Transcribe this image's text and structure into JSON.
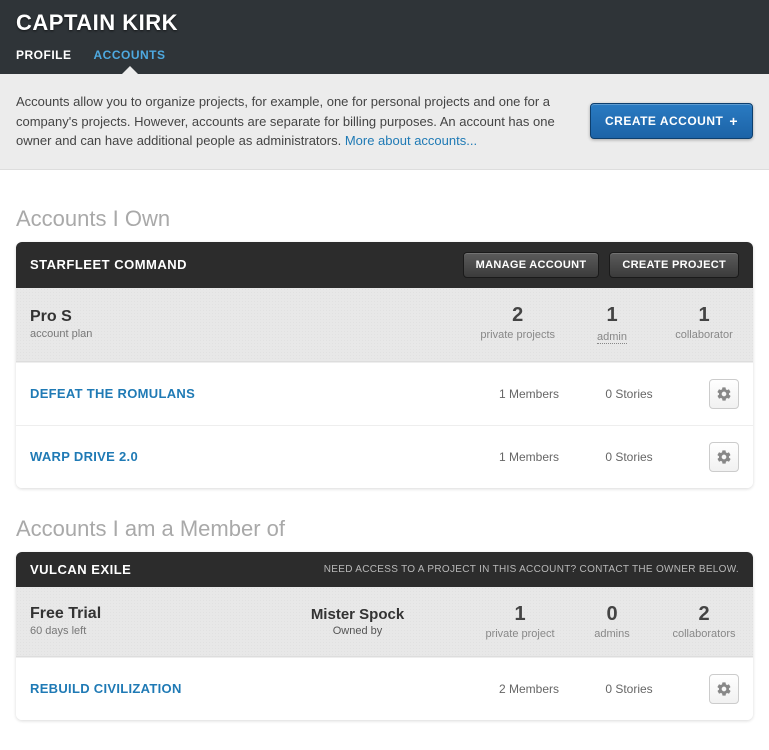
{
  "header": {
    "title": "CAPTAIN KIRK",
    "tabs": [
      {
        "label": "PROFILE",
        "active": false
      },
      {
        "label": "ACCOUNTS",
        "active": true
      }
    ]
  },
  "intro": {
    "text": "Accounts allow you to organize projects, for example, one for personal projects and one for a company's projects. However, accounts are separate for billing purposes. An account has one owner and can have additional people as administrators. ",
    "link_label": "More about accounts...",
    "create_button": "CREATE ACCOUNT"
  },
  "owned": {
    "section_title": "Accounts I Own",
    "account": {
      "name": "STARFLEET COMMAND",
      "manage_btn": "MANAGE ACCOUNT",
      "create_project_btn": "CREATE PROJECT",
      "plan": {
        "name": "Pro S",
        "sub": "account plan"
      },
      "stats": [
        {
          "num": "2",
          "label": "private projects"
        },
        {
          "num": "1",
          "label": "admin",
          "dotted": true
        },
        {
          "num": "1",
          "label": "collaborator"
        }
      ],
      "projects": [
        {
          "name": "DEFEAT THE ROMULANS",
          "members": "1 Members",
          "stories": "0 Stories"
        },
        {
          "name": "WARP DRIVE 2.0",
          "members": "1 Members",
          "stories": "0 Stories"
        }
      ]
    }
  },
  "member": {
    "section_title": "Accounts I am a Member of",
    "account": {
      "name": "VULCAN EXILE",
      "note": "NEED ACCESS TO A PROJECT IN THIS ACCOUNT? CONTACT THE OWNER BELOW.",
      "plan": {
        "name": "Free Trial",
        "sub": "60 days left"
      },
      "owner": {
        "name": "Mister Spock",
        "sub": "Owned by"
      },
      "stats": [
        {
          "num": "1",
          "label": "private project"
        },
        {
          "num": "0",
          "label": "admins"
        },
        {
          "num": "2",
          "label": "collaborators"
        }
      ],
      "projects": [
        {
          "name": "REBUILD CIVILIZATION",
          "members": "2 Members",
          "stories": "0 Stories"
        }
      ]
    }
  }
}
